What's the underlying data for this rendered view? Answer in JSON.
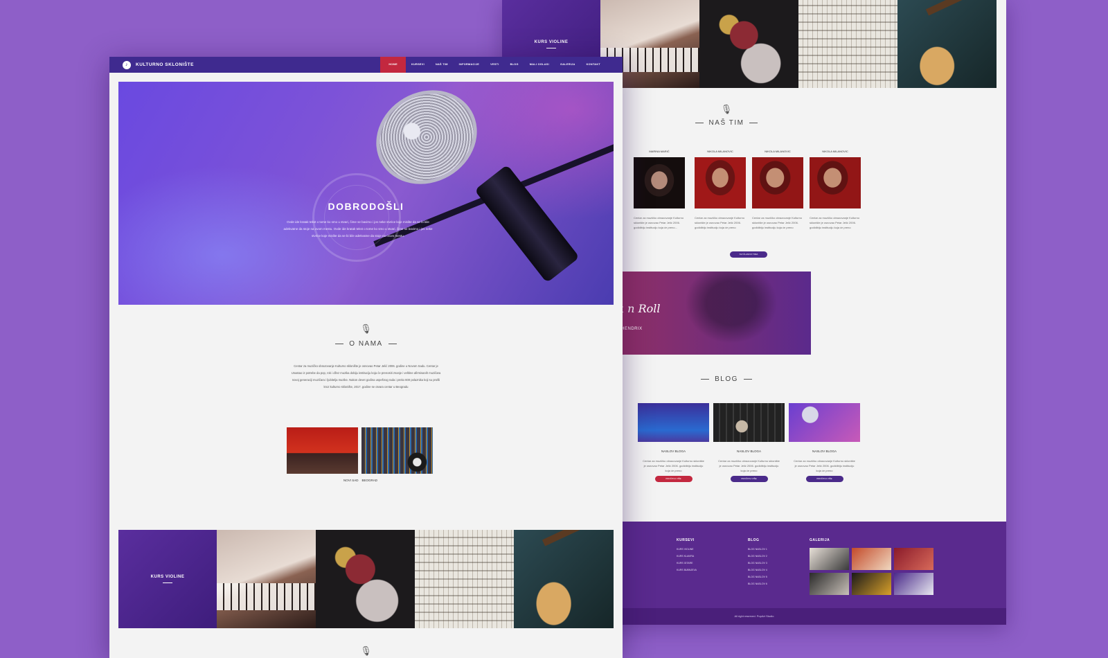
{
  "site": {
    "logo_text": "KULTURNO SKLONIŠTE",
    "nav": [
      "HOME",
      "KURSEVI",
      "NAŠ TIM",
      "INFORMACIJE",
      "VESTI",
      "BLOG",
      "MALI OGLASI",
      "GALERIJA",
      "KONTAKT"
    ],
    "nav_active": "HOME"
  },
  "hero": {
    "title": "DOBRODOŠLI",
    "text": "Ovde ide kratak tekst o tome ko smo u stvari, čime se bavimo i jos neke stvrice koje mislite da se bi bile adekvatne da stoje na ovom mestu. Ovde ide kratak tekst o tome ko smo u stvari, čime se bavimo i jos neke stvrice koje mislite da se bi bile adekvatne da stoje na ovom mestu."
  },
  "about": {
    "title": "O NAMA",
    "text": "Centar za muzičko obrazovanje Kulturno sklonište je osnovao Petar Jelić 2006. godine u Novom Sadu. Centar je Unastao iz potrebe da pop, rok i džez muzika dobiju instituciju koja će prenositi znanje i veštine afirmisanih muzičara novoj generaciji muzičara i ljubitelja muzike. Nakon devet godina uspešnog rada i preko 600 polaznika koji su prošli kroz kulturno sklonište, 2017. godine se otvara centar u Beogradu",
    "locations": [
      "NOVI SAD",
      "BEOGRAD"
    ]
  },
  "courses": {
    "first_label": "KURS VIOLINE"
  },
  "team": {
    "title": "NAŠ TIM",
    "members": [
      {
        "name": "MARINA MARIĆ",
        "text": "Centar za muzičko obrazovanje Kulturno sklonište je osnovao Petar Jelić 2006. godidibiju instituciju koja će preno..."
      },
      {
        "name": "NIKOLA MILANOVIC",
        "text": "Centar za muzičko obrazovanje Kulturno sklonište je osnovao Petar Jelić 2006. godidibiju instituciju koja će preno"
      },
      {
        "name": "NIKOLA MILANOVIC",
        "text": "Centar za muzičko obrazovanje Kulturno sklonište je osnovao Petar Jelić 2006. godidibiju instituciju koja će preno"
      },
      {
        "name": "NIKOLA MILANOVIC",
        "text": "Centar za muzičko obrazovanje Kulturno sklonište je osnovao Petar Jelić 2006. godidibiju instituciju koja će preno"
      }
    ],
    "button": "SVI ČLANOVI TIMA"
  },
  "quote": {
    "text": "Peace Love & Rock n Roll",
    "author": "- JIMI HENDRIX"
  },
  "blog": {
    "title": "BLOG",
    "posts": [
      {
        "title": "NASLOV BLOGA",
        "text": "Centar za muzičko obrazovanje Kulturno sklonište je osnovao Petar Jelić 2006. godidibiju instituciju koja će preno",
        "button": "PROČITAJ VIŠE"
      },
      {
        "title": "NASLOV BLOGA",
        "text": "Centar za muzičko obrazovanje Kulturno sklonište je osnovao Petar Jelić 2006. godidibiju instituciju koja će preno",
        "button": "PROČITAJ VIŠE"
      },
      {
        "title": "NASLOV BLOGA",
        "text": "Centar za muzičko obrazovanje Kulturno sklonište je osnovao Petar Jelić 2006. godidibiju instituciju koja će preno",
        "button": "PROČITAJ VIŠE"
      }
    ]
  },
  "footer": {
    "kursevi_title": "KURSEVI",
    "kursevi": [
      "KURS VIOLINE",
      "KURS KLAVIRA",
      "KURS GITARE",
      "KURS BUBNJEVA"
    ],
    "blog_title": "BLOG",
    "blog": [
      "BLOG NASLOV 1",
      "BLOG NASLOV 2",
      "BLOG NASLOV 3",
      "BLOG NASLOV 4",
      "BLOG NASLOV 5",
      "BLOG NASLOV 6"
    ],
    "galerija_title": "GALERIJA",
    "copyright": "All right reserved. PopArt Studio"
  },
  "colors": {
    "background": "#8e5fc8",
    "navbar": "#3f2a8f",
    "accent_red": "#c3283f",
    "purple_dark": "#5a2a8e",
    "button_purple": "#4a2a8a"
  }
}
